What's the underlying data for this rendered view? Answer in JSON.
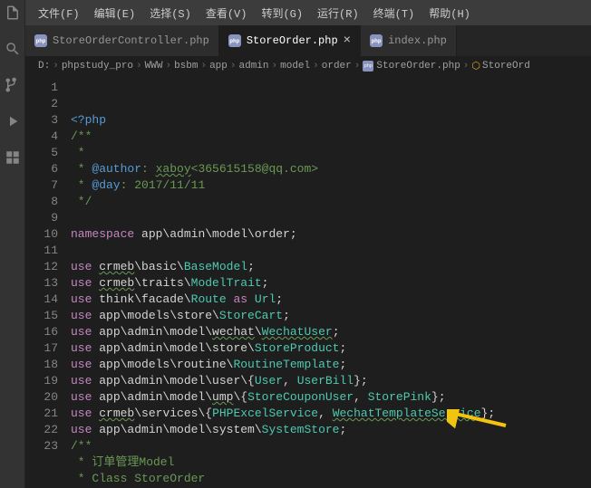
{
  "menubar": [
    {
      "label": "文件(F)"
    },
    {
      "label": "编辑(E)"
    },
    {
      "label": "选择(S)"
    },
    {
      "label": "查看(V)"
    },
    {
      "label": "转到(G)"
    },
    {
      "label": "运行(R)"
    },
    {
      "label": "终端(T)"
    },
    {
      "label": "帮助(H)"
    }
  ],
  "tabs": [
    {
      "label": "StoreOrderController.php",
      "active": false
    },
    {
      "label": "StoreOrder.php",
      "active": true
    },
    {
      "label": "index.php",
      "active": false
    }
  ],
  "close_glyph": "×",
  "breadcrumb": {
    "drive": "D:",
    "parts": [
      "phpstudy_pro",
      "WWW",
      "bsbm",
      "app",
      "admin",
      "model",
      "order"
    ],
    "file": "StoreOrder.php",
    "symbol": "StoreOrd"
  },
  "lines": [
    {
      "n": 1,
      "html": "<span class='c-tag'>&lt;?php</span>"
    },
    {
      "n": 2,
      "html": "<span class='c-com'>/**</span>"
    },
    {
      "n": 3,
      "html": "<span class='c-com'> *</span>"
    },
    {
      "n": 4,
      "html": "<span class='c-com'> * </span><span class='c-tag'>@author</span><span class='c-com'>: </span><span class='c-com squiggle'>xaboy</span><span class='c-com'>&lt;365615158@qq.com&gt;</span>"
    },
    {
      "n": 5,
      "html": "<span class='c-com'> * </span><span class='c-tag'>@day</span><span class='c-com'>: 2017/11/11</span>"
    },
    {
      "n": 6,
      "html": "<span class='c-com'> */</span>"
    },
    {
      "n": 7,
      "html": ""
    },
    {
      "n": 8,
      "html": "<span class='c-key'>namespace</span> <span class='c-ns'>app\\admin\\model\\order</span><span class='c-punc'>;</span>"
    },
    {
      "n": 9,
      "html": ""
    },
    {
      "n": 10,
      "html": "<span class='c-key'>use</span> <span class='c-ns squiggle'>crmeb</span><span class='c-ns'>\\basic\\</span><span class='c-cls'>BaseModel</span><span class='c-punc'>;</span>"
    },
    {
      "n": 11,
      "html": "<span class='c-key'>use</span> <span class='c-ns squiggle'>crmeb</span><span class='c-ns'>\\traits\\</span><span class='c-cls'>ModelTrait</span><span class='c-punc'>;</span>"
    },
    {
      "n": 12,
      "html": "<span class='c-key'>use</span> <span class='c-ns'>think\\facade\\</span><span class='c-cls'>Route</span> <span class='c-key'>as</span> <span class='c-cls'>Url</span><span class='c-punc'>;</span>"
    },
    {
      "n": 13,
      "html": "<span class='c-key'>use</span> <span class='c-ns'>app\\models\\store\\</span><span class='c-cls'>StoreCart</span><span class='c-punc'>;</span>"
    },
    {
      "n": 14,
      "html": "<span class='c-key'>use</span> <span class='c-ns'>app\\admin\\model\\</span><span class='c-ns squiggle'>wechat</span><span class='c-ns'>\\</span><span class='c-cls squiggle'>WechatUser</span><span class='c-punc'>;</span>"
    },
    {
      "n": 15,
      "html": "<span class='c-key'>use</span> <span class='c-ns'>app\\admin\\model\\store\\</span><span class='c-cls'>StoreProduct</span><span class='c-punc'>;</span>"
    },
    {
      "n": 16,
      "html": "<span class='c-key'>use</span> <span class='c-ns'>app\\models\\routine\\</span><span class='c-cls'>RoutineTemplate</span><span class='c-punc'>;</span>"
    },
    {
      "n": 17,
      "html": "<span class='c-key'>use</span> <span class='c-ns'>app\\admin\\model\\user\\{</span><span class='c-cls'>User</span><span class='c-punc'>, </span><span class='c-cls'>UserBill</span><span class='c-punc'>};</span>"
    },
    {
      "n": 18,
      "html": "<span class='c-key'>use</span> <span class='c-ns'>app\\admin\\model\\</span><span class='c-ns squiggle'>ump</span><span class='c-ns'>\\{</span><span class='c-cls'>StoreCouponUser</span><span class='c-punc'>, </span><span class='c-cls'>StorePink</span><span class='c-punc'>};</span>"
    },
    {
      "n": 19,
      "html": "<span class='c-key'>use</span> <span class='c-ns squiggle'>crmeb</span><span class='c-ns'>\\services\\{</span><span class='c-cls'>PHPExcelService</span><span class='c-punc'>, </span><span class='c-cls squiggle'>WechatTemplateService</span><span class='c-punc'>};</span>"
    },
    {
      "n": 20,
      "html": "<span class='c-key'>use</span> <span class='c-ns'>app\\admin\\model\\system\\</span><span class='c-cls'>SystemStore</span><span class='c-punc'>;</span>"
    },
    {
      "n": 21,
      "html": "<span class='c-com'>/**</span>"
    },
    {
      "n": 22,
      "html": "<span class='c-com'> * 订单管理Model</span>"
    },
    {
      "n": 23,
      "html": "<span class='c-com'> * Class StoreOrder</span>"
    }
  ]
}
